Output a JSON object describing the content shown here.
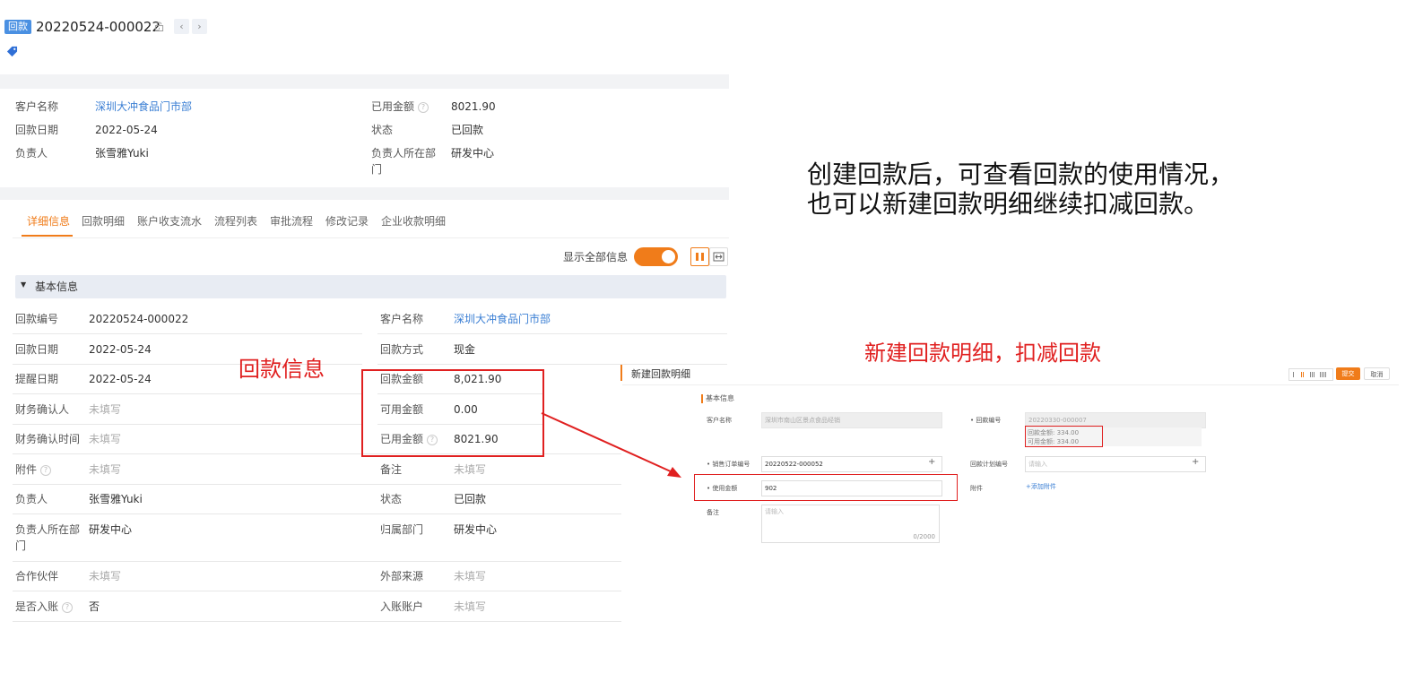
{
  "header": {
    "badge": "回款",
    "record_no": "20220524-000022",
    "prev": "‹",
    "next": "›"
  },
  "summary": {
    "left": [
      {
        "label": "客户名称",
        "value": "深圳大冲食品门市部",
        "link": true
      },
      {
        "label": "回款日期",
        "value": "2022-05-24"
      },
      {
        "label": "负责人",
        "value": "张雪雅Yuki"
      }
    ],
    "right": [
      {
        "label": "已用金额",
        "value": "8021.90",
        "help": "?"
      },
      {
        "label": "状态",
        "value": "已回款"
      },
      {
        "label_line1": "负责人所在部",
        "label_line2": "门",
        "value": "研发中心"
      }
    ]
  },
  "tabs": [
    "详细信息",
    "回款明细",
    "账户收支流水",
    "流程列表",
    "审批流程",
    "修改记录",
    "企业收款明细"
  ],
  "toolbar": {
    "show_all_label": "显示全部信息"
  },
  "section": {
    "title": "基本信息",
    "caret": "▼"
  },
  "detail_left": [
    {
      "label": "回款编号",
      "value": "20220524-000022"
    },
    {
      "label": "回款日期",
      "value": "2022-05-24"
    },
    {
      "label": "提醒日期",
      "value": "2022-05-24"
    },
    {
      "label": "财务确认人",
      "value": "未填写",
      "muted": true
    },
    {
      "label": "财务确认时间",
      "value": "未填写",
      "muted": true
    },
    {
      "label": "附件",
      "value": "未填写",
      "muted": true,
      "help": "?"
    },
    {
      "label": "负责人",
      "value": "张雪雅Yuki"
    },
    {
      "label_line1": "负责人所在部",
      "label_line2": "门",
      "value": "研发中心"
    },
    {
      "label": "合作伙伴",
      "value": "未填写",
      "muted": true
    },
    {
      "label": "是否入账",
      "value": "否",
      "help": "?"
    }
  ],
  "detail_right": [
    {
      "label": "客户名称",
      "value": "深圳大冲食品门市部",
      "link": true
    },
    {
      "label": "回款方式",
      "value": "现金"
    },
    {
      "label": "回款金额",
      "value": "8,021.90"
    },
    {
      "label": "可用金额",
      "value": "0.00"
    },
    {
      "label": "已用金额",
      "value": "8021.90",
      "help": "?"
    },
    {
      "label": "备注",
      "value": "未填写",
      "muted": true
    },
    {
      "label": "状态",
      "value": "已回款"
    },
    {
      "label": "归属部门",
      "value": "研发中心"
    },
    {
      "label": "外部来源",
      "value": "未填写",
      "muted": true
    },
    {
      "label": "入账账户",
      "value": "未填写",
      "muted": true
    }
  ],
  "annotations": {
    "payment_info": "回款信息",
    "note": "创建回款后，可查看回款的使用情况，也可以新建回款明细继续扣减回款。",
    "new_detail_title": "新建回款明细，扣减回款"
  },
  "mini_form": {
    "title": "新建回款明细",
    "submit": "提交",
    "cancel": "取消",
    "section": "基本信息",
    "customer_label": "客户名称",
    "customer_value": "深圳市南山区景点食品经销",
    "payment_no_label": "• 回款编号",
    "payment_no_value": "20220330-000007",
    "payment_amount": "回款金额: 334.00",
    "available_amount": "可用金额: 334.00",
    "order_label": "• 销售订单编号",
    "order_value": "20220522-000052",
    "plan_label": "回款计划编号",
    "plan_placeholder": "请输入",
    "used_label": "• 使用金额",
    "used_value": "902",
    "attach_label": "附件",
    "attach_link": "+添加附件",
    "remark_label": "备注",
    "remark_placeholder": "请输入",
    "remark_count": "0/2000",
    "plus": "+"
  },
  "colors": {
    "accent": "#f07c1a",
    "link": "#3b7fd4",
    "highlight": "#e02020"
  }
}
